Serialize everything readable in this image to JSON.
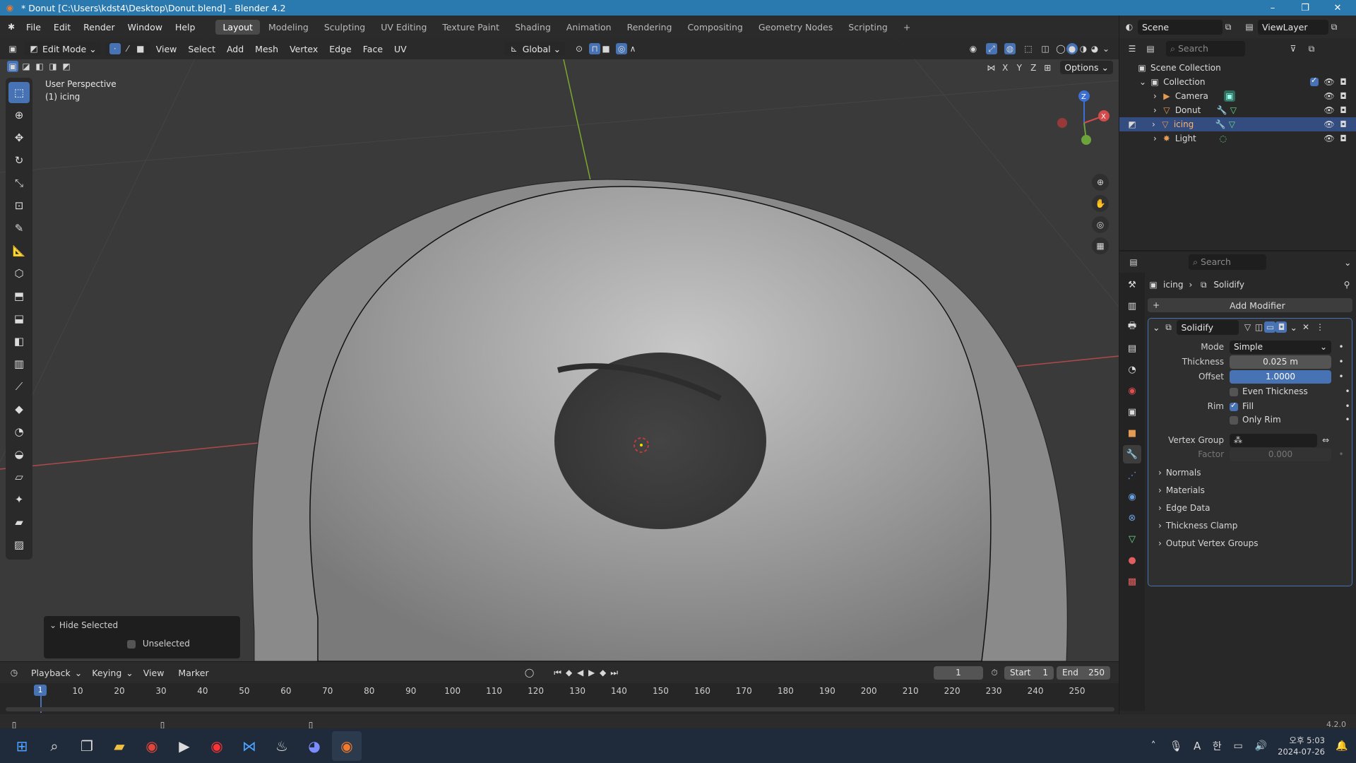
{
  "title_bar": {
    "title": "* Donut [C:\\Users\\kdst4\\Desktop\\Donut.blend] - Blender 4.2",
    "minimize": "–",
    "maximize": "❐",
    "close": "✕"
  },
  "top_menu": [
    "File",
    "Edit",
    "Render",
    "Window",
    "Help"
  ],
  "workspaces": [
    "Layout",
    "Modeling",
    "Sculpting",
    "UV Editing",
    "Texture Paint",
    "Shading",
    "Animation",
    "Rendering",
    "Compositing",
    "Geometry Nodes",
    "Scripting"
  ],
  "active_workspace": "Layout",
  "scene": {
    "scene_name": "Scene",
    "view_layer": "ViewLayer"
  },
  "viewport": {
    "mode": "Edit Mode",
    "header_menus": [
      "View",
      "Select",
      "Add",
      "Mesh",
      "Vertex",
      "Edge",
      "Face",
      "UV"
    ],
    "transform_orientation": "Global",
    "options_label": "Options",
    "axis_labels": [
      "X",
      "Y",
      "Z"
    ],
    "perspective_text": "User Perspective",
    "object_text": "(1) icing",
    "gizmo": {
      "x": "X",
      "y": "Y",
      "z": "Z"
    }
  },
  "hide_panel": {
    "title": "Hide Selected",
    "option": "Unselected"
  },
  "timeline": {
    "menus": [
      "Playback",
      "Keying",
      "View",
      "Marker"
    ],
    "current_frame": "1",
    "start_label": "Start",
    "start": "1",
    "end_label": "End",
    "end": "250",
    "ruler": [
      "1",
      "10",
      "20",
      "30",
      "40",
      "50",
      "60",
      "70",
      "80",
      "90",
      "100",
      "110",
      "120",
      "130",
      "140",
      "150",
      "160",
      "170",
      "180",
      "190",
      "200",
      "210",
      "220",
      "230",
      "240",
      "250"
    ]
  },
  "outliner": {
    "search_placeholder": "Search",
    "scene_collection": "Scene Collection",
    "collection": "Collection",
    "items": [
      {
        "name": "Camera"
      },
      {
        "name": "Donut"
      },
      {
        "name": "icing"
      },
      {
        "name": "Light"
      }
    ]
  },
  "properties": {
    "search_placeholder": "Search",
    "breadcrumb_object": "icing",
    "breadcrumb_modifier": "Solidify",
    "add_modifier": "Add Modifier",
    "modifier_name": "Solidify",
    "fields": {
      "mode_label": "Mode",
      "mode": "Simple",
      "thickness_label": "Thickness",
      "thickness": "0.025 m",
      "offset_label": "Offset",
      "offset": "1.0000",
      "even_thickness": "Even Thickness",
      "rim_label": "Rim",
      "fill": "Fill",
      "only_rim": "Only Rim",
      "vertex_group_label": "Vertex Group",
      "factor_label": "Factor",
      "factor": "0.000"
    },
    "subpanels": [
      "Normals",
      "Materials",
      "Edge Data",
      "Thickness Clamp",
      "Output Vertex Groups"
    ]
  },
  "status_bar": {
    "version": "4.2.0"
  },
  "taskbar": {
    "time": "오후 5:03",
    "date": "2024-07-26",
    "ime": "A",
    "ime2": "한"
  }
}
